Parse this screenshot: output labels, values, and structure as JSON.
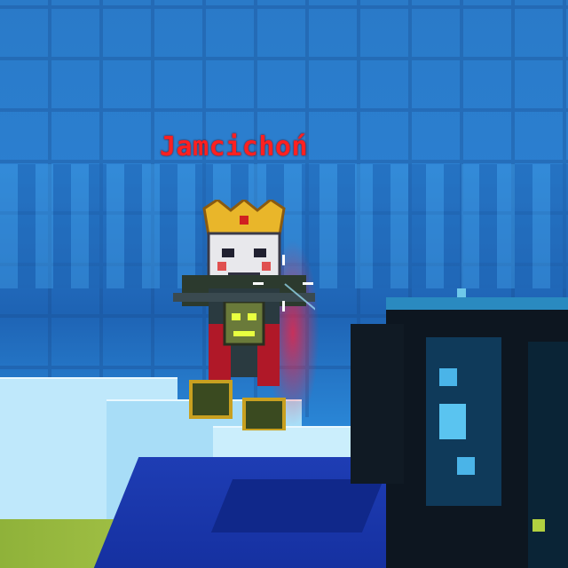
{
  "hud": {
    "enemy_name": "Jamcichoń"
  },
  "icons": {
    "crosshair": "crosshair-icon",
    "player": "enemy-player-avatar",
    "weapon": "first-person-weapon"
  },
  "colors": {
    "enemy_name": "#ff2020",
    "wall": "#2a7ac8",
    "floor": "#1e3db4"
  }
}
